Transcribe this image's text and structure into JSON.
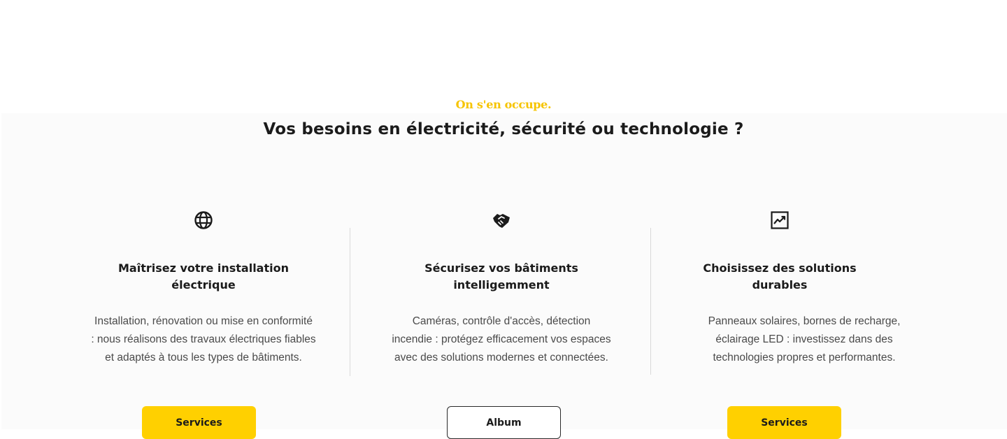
{
  "header": {
    "tagline": "On s'en occupe.",
    "title": "Vos besoins en électricité, sécurité ou technologie ?"
  },
  "columns": [
    {
      "icon": "globe-icon",
      "title_lines": [
        "Maîtrisez votre installation",
        "électrique"
      ],
      "desc_lines": [
        "Installation, rénovation ou mise en conformité",
        ": nous réalisons des travaux électriques fiables",
        "et adaptés à tous les types de bâtiments."
      ],
      "button_label": "Services"
    },
    {
      "icon": "handshake-icon",
      "title_lines": [
        "Sécurisez vos bâtiments",
        "intelligemment"
      ],
      "desc_lines": [
        "Caméras, contrôle d'accès, détection",
        "incendie : protégez efficacement vos espaces",
        "avec des solutions modernes et connectées."
      ],
      "button_label": "Album"
    },
    {
      "icon": "trending-up-chart-icon",
      "title_lines": [
        "Choisissez des solutions",
        "durables"
      ],
      "desc_lines": [
        "Panneaux solaires, bornes de recharge,",
        "éclairage LED : investissez dans des",
        "technologies propres et performantes."
      ],
      "button_label": "Services"
    }
  ],
  "colors": {
    "accent": "#ffd000",
    "tagline": "#f6c400",
    "text": "#1b1b1b",
    "muted_text": "#4a4a4a",
    "divider": "#d9d9d9",
    "section_background": "#fbfbfb"
  }
}
